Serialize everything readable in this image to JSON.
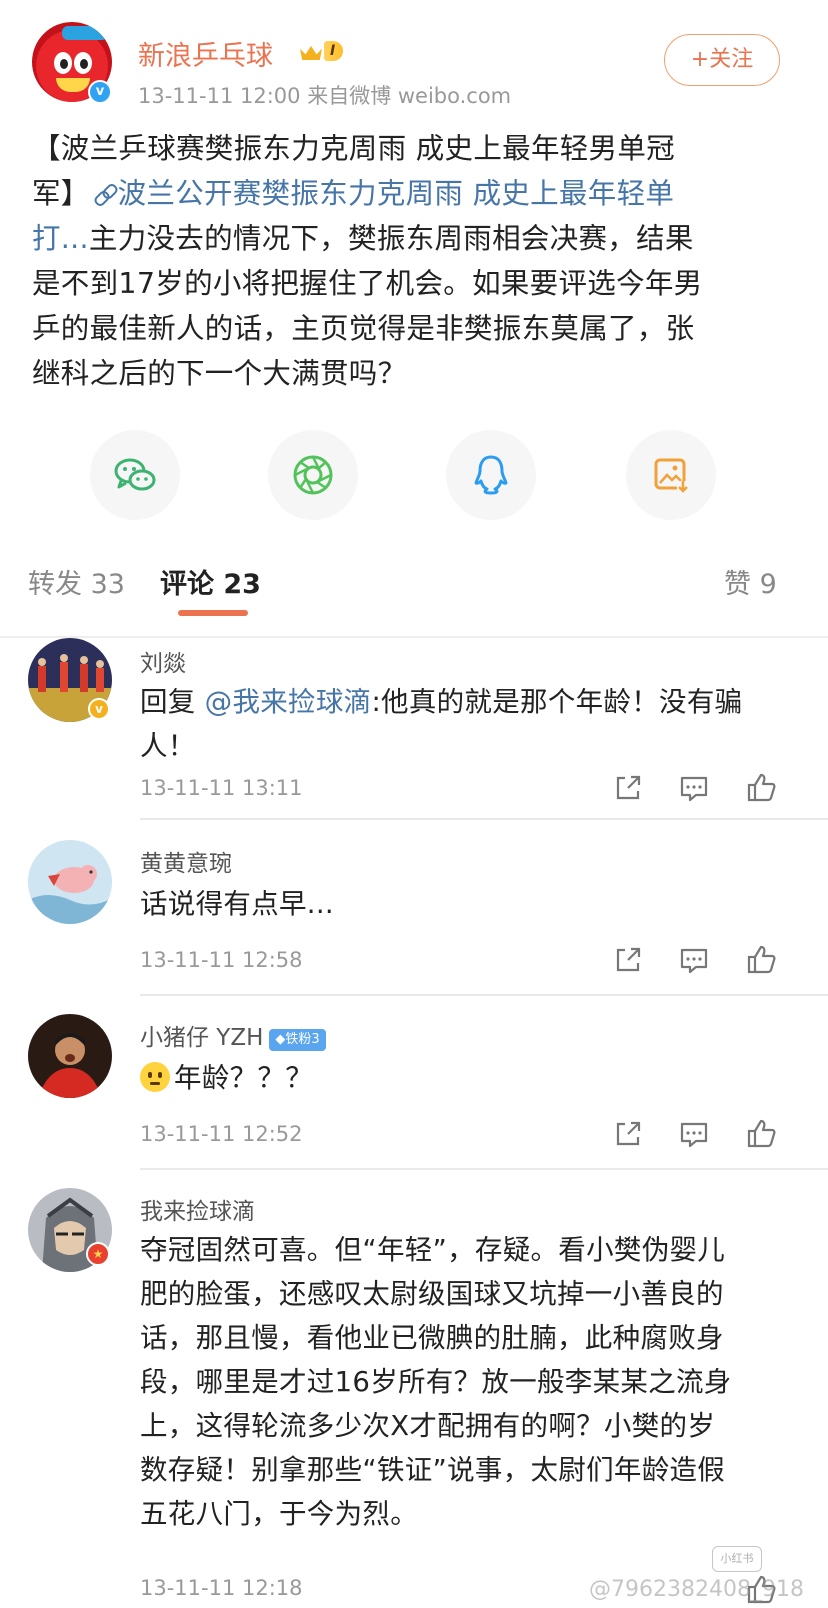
{
  "post": {
    "author": "新浪乒乓球",
    "level": "I",
    "meta": "13-11-11 12:00  来自微博 weibo.com",
    "follow_label": "+关注",
    "body_line1": "【波兰乒球赛樊振东力克周雨 成史上最年轻男单冠",
    "body_line2_a": "军】",
    "body_line2_link": "波兰公开赛樊振东力克周雨 成史上最年轻单",
    "body_line3_link": "打...",
    "body_line3_rest": "主力没去的情况下，樊振东周雨相会决赛，结果",
    "body_line4": "是不到17岁的小将把握住了机会。如果要评选今年男",
    "body_line5": "乒的最佳新人的话，主页觉得是非樊振东莫属了，张",
    "body_line6": "继科之后的下一个大满贯吗？"
  },
  "share": {
    "icons": [
      "wechat-icon",
      "moments-icon",
      "qq-icon",
      "save-image-icon"
    ],
    "colors": {
      "wechat": "#3cb371",
      "moments": "#52c35a",
      "qq": "#2b9cf0",
      "save": "#f0a13a"
    }
  },
  "tabs": {
    "repost": "转发 33",
    "comments": "评论 23",
    "likes": "赞 9"
  },
  "comments": [
    {
      "name": "刘燚",
      "prefix": "回复 ",
      "mention": "@我来捡球滴",
      "text_line1": ":他真的就是那个年龄！没有骗",
      "text_line2": "人！",
      "time": "13-11-11 13:11"
    },
    {
      "name": "黄黄意琬",
      "text_line1": "话说得有点早...",
      "time": "13-11-11 12:58"
    },
    {
      "name": "小猪仔 YZH",
      "badge": "铁粉3",
      "text_line1": "年龄？？？",
      "time": "13-11-11 12:52"
    },
    {
      "name": "我来捡球滴",
      "text_line1": "夺冠固然可喜。但“年轻”，存疑。看小樊伪婴儿",
      "text_line2": "肥的脸蛋，还感叹太尉级国球又坑掉一小善良的",
      "text_line3": "话，那且慢，看他业已微腆的肚腩，此种腐败身",
      "text_line4": "段，哪里是才过16岁所有？放一般李某某之流身",
      "text_line5": "上，这得轮流多少次X才配拥有的啊？小樊的岁",
      "text_line6": "数存疑！别拿那些“铁证”说事，太尉们年龄造假",
      "text_line7": "五花八门，于今为烈。",
      "time": "13-11-11 12:18"
    }
  ],
  "watermark": "@7962382408_918",
  "watermark_logo": "小红书",
  "accent_color": "#eb7350",
  "link_color": "#4675a8"
}
